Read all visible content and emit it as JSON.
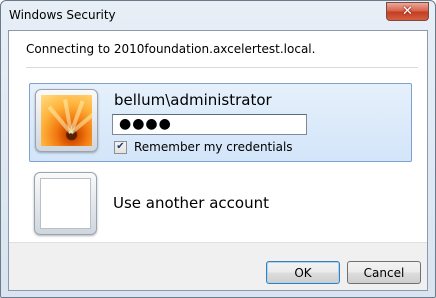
{
  "window": {
    "title": "Windows Security",
    "close_glyph": "✕"
  },
  "message": "Connecting to 2010foundation.axcelertest.local.",
  "account": {
    "username": "bellum\\administrator",
    "password_mask": "●●●●",
    "remember_checked": true,
    "remember_label": "Remember my credentials",
    "checkbox_glyph": "✔"
  },
  "other_account": {
    "label": "Use another account"
  },
  "buttons": {
    "ok": "OK",
    "cancel": "Cancel"
  },
  "colors": {
    "selected_tile": "#d3e5fa",
    "selected_border": "#7da2ce",
    "default_button_border": "#3c7fb1"
  }
}
